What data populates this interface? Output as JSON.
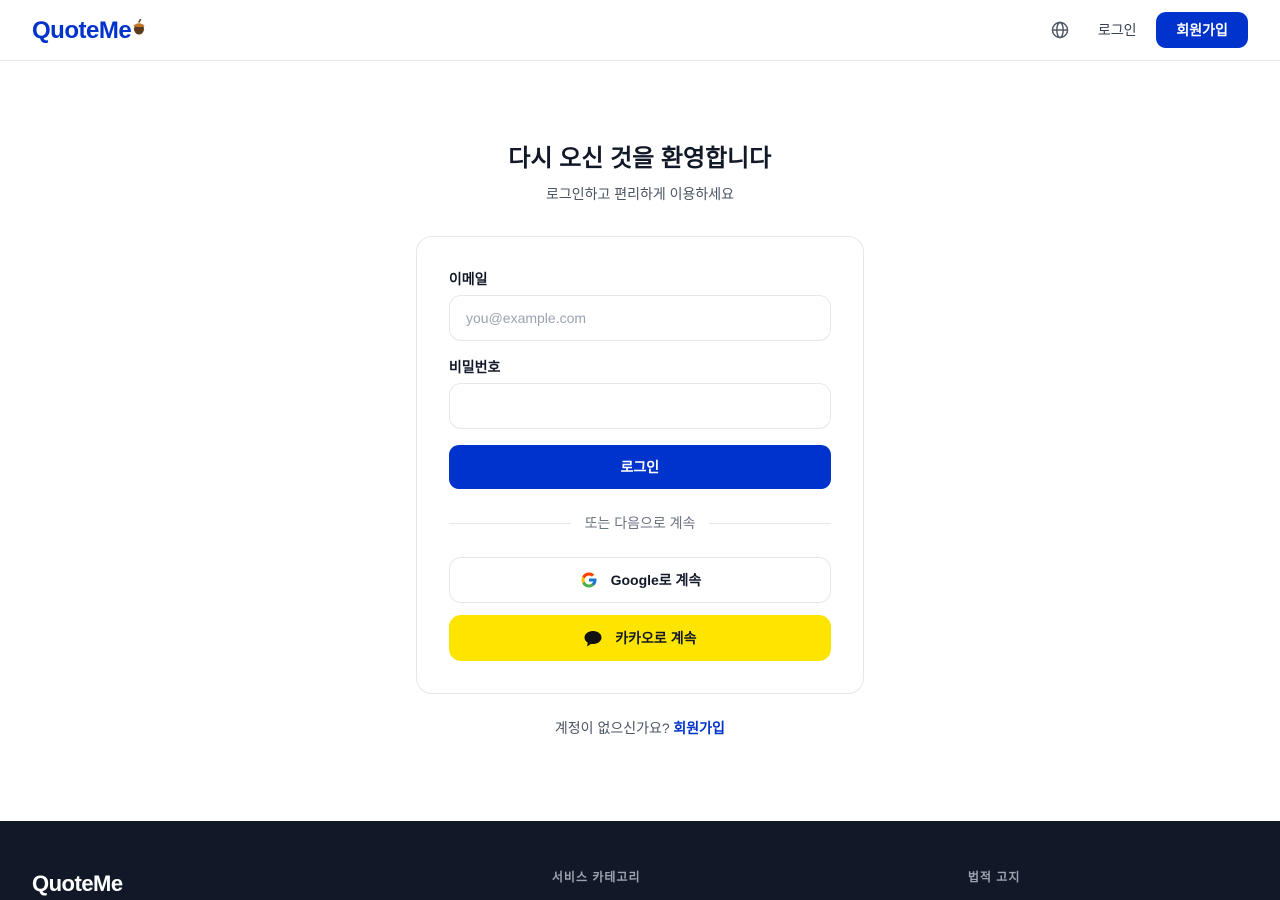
{
  "header": {
    "logo": "QuoteMe",
    "language_icon": "globe-icon",
    "login_label": "로그인",
    "signup_label": "회원가입"
  },
  "main": {
    "title": "다시 오신 것을 환영합니다",
    "subtitle": "로그인하고 편리하게 이용하세요"
  },
  "form": {
    "email_label": "이메일",
    "email_placeholder": "you@example.com",
    "email_value": "",
    "password_label": "비밀번호",
    "password_value": "",
    "submit_label": "로그인",
    "divider_text": "또는 다음으로 계속",
    "google_label": "Google로 계속",
    "google_icon": "google-icon",
    "kakao_label": "카카오로 계속",
    "kakao_icon": "chat-bubble-icon"
  },
  "signup_prompt": {
    "text": "계정이 없으신가요?",
    "link": "회원가입"
  },
  "footer": {
    "logo": "QuoteMe",
    "col_services": "서비스 카테고리",
    "col_legal": "법적 고지"
  },
  "colors": {
    "brand": "#0033cc",
    "kakao": "#fee500",
    "footer_bg": "#111827"
  }
}
